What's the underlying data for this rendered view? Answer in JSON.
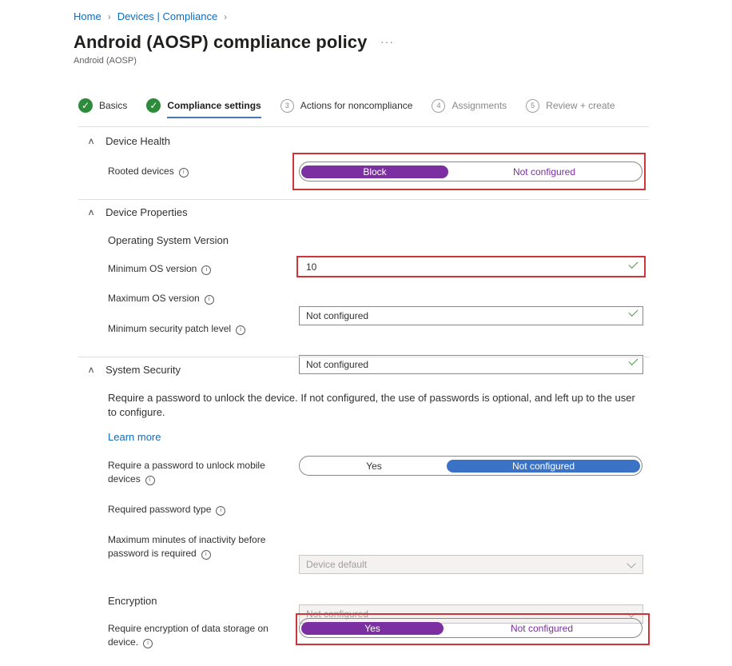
{
  "breadcrumb": {
    "home": "Home",
    "devices": "Devices | Compliance"
  },
  "page": {
    "title": "Android (AOSP) compliance policy",
    "subtitle": "Android (AOSP)",
    "more": "···"
  },
  "steps": [
    {
      "label": "Basics",
      "state": "done"
    },
    {
      "label": "Compliance settings",
      "state": "active"
    },
    {
      "num": "3",
      "label": "Actions for noncompliance",
      "state": "next"
    },
    {
      "num": "4",
      "label": "Assignments",
      "state": "todo"
    },
    {
      "num": "5",
      "label": "Review + create",
      "state": "todo"
    }
  ],
  "device_health": {
    "title": "Device Health",
    "rooted": {
      "label": "Rooted devices",
      "option_a": "Block",
      "option_b": "Not configured",
      "selected": "Block"
    }
  },
  "device_properties": {
    "title": "Device Properties",
    "os_heading": "Operating System Version",
    "min_os": {
      "label": "Minimum OS version",
      "value": "10"
    },
    "max_os": {
      "label": "Maximum OS version",
      "value": "Not configured"
    },
    "patch": {
      "label": "Minimum security patch level",
      "value": "Not configured"
    }
  },
  "system_security": {
    "title": "System Security",
    "description": "Require a password to unlock the device. If not configured, the use of passwords is optional, and left up to the user to configure.",
    "learn_more": "Learn more",
    "require_password": {
      "label_line1": "Require a password to unlock mobile",
      "label_line2": "devices",
      "option_a": "Yes",
      "option_b": "Not configured",
      "selected": "Not configured"
    },
    "password_type": {
      "label": "Required password type",
      "value": "Device default"
    },
    "inactivity": {
      "label_line1": "Maximum minutes of inactivity before",
      "label_line2": "password is required",
      "value": "Not configured"
    },
    "encryption_heading": "Encryption",
    "encryption": {
      "label_line1": "Require encryption of data storage on",
      "label_line2": "device.",
      "option_a": "Yes",
      "option_b": "Not configured",
      "selected": "Yes"
    }
  },
  "colors": {
    "accent_purple": "#7b2fa0",
    "accent_blue": "#3a73c6",
    "highlight_red": "#d13438",
    "link": "#0f6cbd",
    "success": "#2e8b3c"
  }
}
